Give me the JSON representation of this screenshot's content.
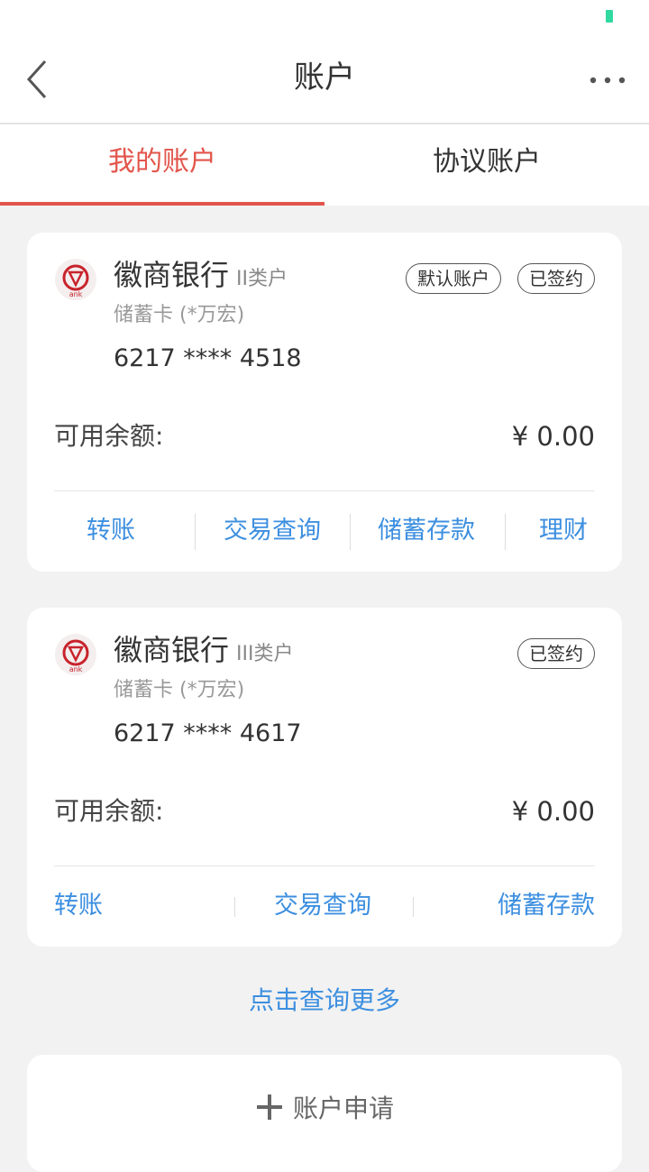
{
  "status_bar": {
    "battery_color": "#2fd9a0"
  },
  "header": {
    "title": "账户",
    "back_icon": "chevron-left-icon",
    "more_icon": "more-dots-icon"
  },
  "tabs": [
    {
      "label": "我的账户",
      "active": true
    },
    {
      "label": "协议账户",
      "active": false
    }
  ],
  "accounts": [
    {
      "bank_name": "徽商银行",
      "account_class": "II类户",
      "card_type": "储蓄卡 (*万宏)",
      "card_number": "6217 **** 4518",
      "badges": [
        "默认账户",
        "已签约"
      ],
      "balance_label": "可用余额:",
      "balance_value": "¥ 0.00",
      "actions": [
        "转账",
        "交易查询",
        "储蓄存款",
        "理财"
      ]
    },
    {
      "bank_name": "徽商银行",
      "account_class": "III类户",
      "card_type": "储蓄卡 (*万宏)",
      "card_number": "6217 **** 4617",
      "badges": [
        "已签约"
      ],
      "balance_label": "可用余额:",
      "balance_value": "¥ 0.00",
      "actions": [
        "转账",
        "交易查询",
        "储蓄存款"
      ]
    }
  ],
  "query_more": "点击查询更多",
  "apply": {
    "label": "账户申请",
    "icon": "plus-icon"
  },
  "colors": {
    "accent_red": "#e2554b",
    "link_blue": "#3d8fe0",
    "background": "#f2f2f2"
  }
}
